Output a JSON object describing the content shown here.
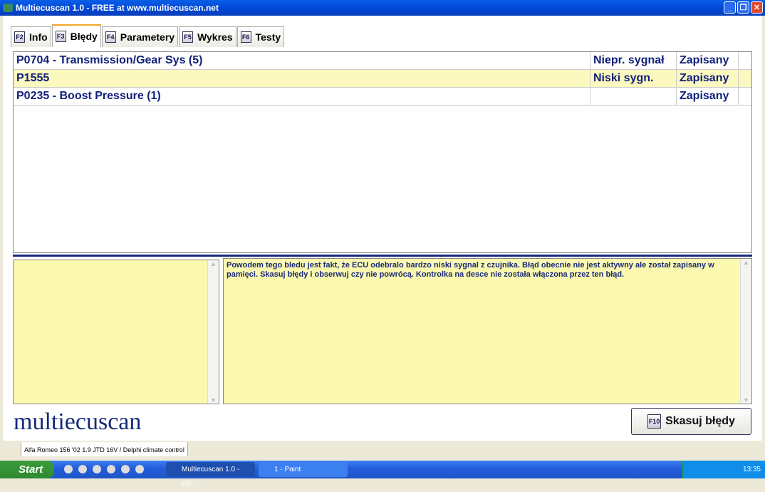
{
  "window": {
    "title": "Multiecuscan 1.0 - FREE at www.multiecuscan.net"
  },
  "tabs": [
    {
      "key": "F2",
      "label": "Info"
    },
    {
      "key": "F3",
      "label": "Błędy"
    },
    {
      "key": "F4",
      "label": "Parametery"
    },
    {
      "key": "F5",
      "label": "Wykres"
    },
    {
      "key": "F6",
      "label": "Testy"
    }
  ],
  "faults": [
    {
      "code": "P0704 - Transmission/Gear Sys (5)",
      "type": "Niepr. sygnał",
      "status": "Zapisany"
    },
    {
      "code": "P1555",
      "type": "Niski sygn.",
      "status": "Zapisany"
    },
    {
      "code": "P0235 - Boost Pressure (1)",
      "type": "",
      "status": "Zapisany"
    }
  ],
  "description": "Powodem tego bledu jest fakt, że ECU odebralo bardzo niski sygnal z czujnika. Błąd obecnie nie jest aktywny ale został zapisany w pamięci. Skasuj błędy i obserwuj czy nie powrócą. Kontrolka na desce nie została włączona przez ten błąd.",
  "logo": "multiecuscan",
  "clear_button": {
    "key": "F10",
    "label": "Skasuj błędy"
  },
  "status_bar": "Alfa Romeo 156 '02 1.9 JTD 16V / Delphi climate control",
  "taskbar": {
    "start": "Start",
    "tasks": [
      "Multiecuscan 1.0 - FR...",
      "1 - Paint"
    ],
    "clock": "13:35"
  }
}
